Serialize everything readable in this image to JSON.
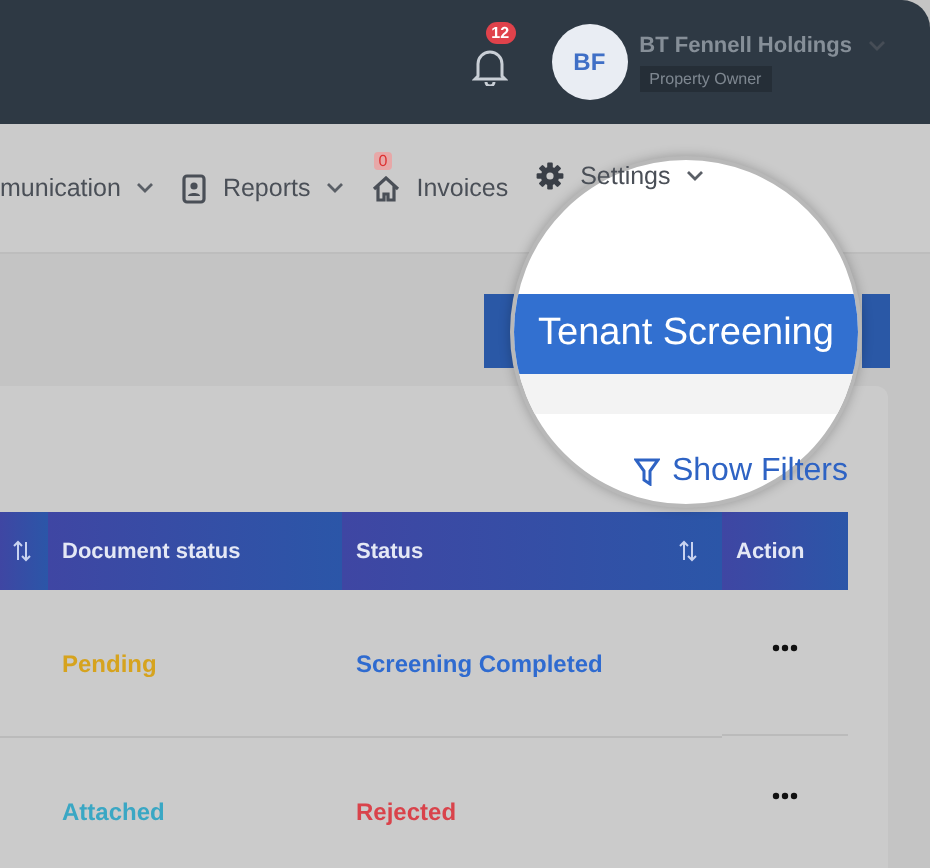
{
  "top_bar": {
    "notifications": {
      "count": "12"
    },
    "user": {
      "initials": "BF",
      "name": "BT Fennell Holdings",
      "role": "Property Owner"
    }
  },
  "nav": [
    {
      "label": "munication",
      "kind": "plain",
      "dropdown": true
    },
    {
      "label": "Reports",
      "kind": "contact",
      "dropdown": true
    },
    {
      "label": "Invoices",
      "kind": "home",
      "badge": "0",
      "dropdown": false
    },
    {
      "label": "Settings",
      "kind": "gear",
      "dropdown": true
    }
  ],
  "primary_button": {
    "label": "Tenant Screening"
  },
  "filters_link": {
    "label": "Show Filters"
  },
  "table": {
    "columns": [
      {
        "kind": "cut",
        "sortable": true
      },
      {
        "kind": "text",
        "label": "Document status",
        "sortable": false
      },
      {
        "kind": "text",
        "label": "Status",
        "sortable": true
      },
      {
        "kind": "text",
        "label": "Action",
        "sortable": false
      }
    ],
    "rows": [
      {
        "document_status": {
          "text": "Pending",
          "color": "#d6a31e"
        },
        "status": {
          "text": "Screening Completed",
          "color": "#2f6bd0"
        }
      },
      {
        "document_status": {
          "text": "Attached",
          "color": "#3aa7c4"
        },
        "status": {
          "text": "Rejected",
          "color": "#d9434b"
        }
      }
    ]
  }
}
